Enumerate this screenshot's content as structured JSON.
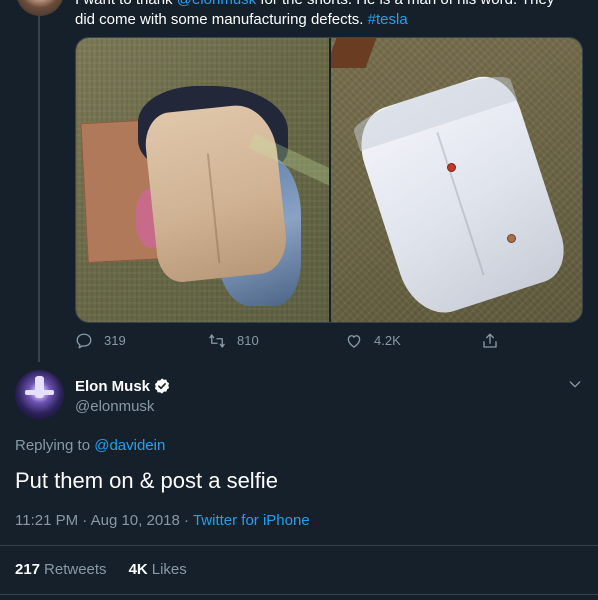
{
  "previous_tweet": {
    "text_before": "I want to thank ",
    "mention": "@elonmusk",
    "text_after": " for the shorts. He is a man of his word.  They",
    "line2": "did come with some manufacturing defects. ",
    "hashtag": "#tesla",
    "actions": {
      "replies": "319",
      "retweets": "810",
      "likes": "4.2K"
    }
  },
  "main_tweet": {
    "display_name": "Elon Musk",
    "handle": "@elonmusk",
    "replying_label": "Replying to ",
    "replying_to": "@davidein",
    "text": "Put them on & post a selfie",
    "time": "11:21 PM",
    "date": "Aug 10, 2018",
    "separator": "·",
    "source": "Twitter for iPhone",
    "retweets_count": "217",
    "retweets_label": "Retweets",
    "likes_count": "4K",
    "likes_label": "Likes"
  },
  "icons": {
    "reply": "reply-icon",
    "retweet": "retweet-icon",
    "like": "heart-icon",
    "share": "share-icon",
    "verified": "verified-badge-icon",
    "more": "chevron-down-icon"
  },
  "colors": {
    "background": "#15202b",
    "accent": "#1da1f2",
    "muted": "#8899a6",
    "divider": "#38444d"
  }
}
